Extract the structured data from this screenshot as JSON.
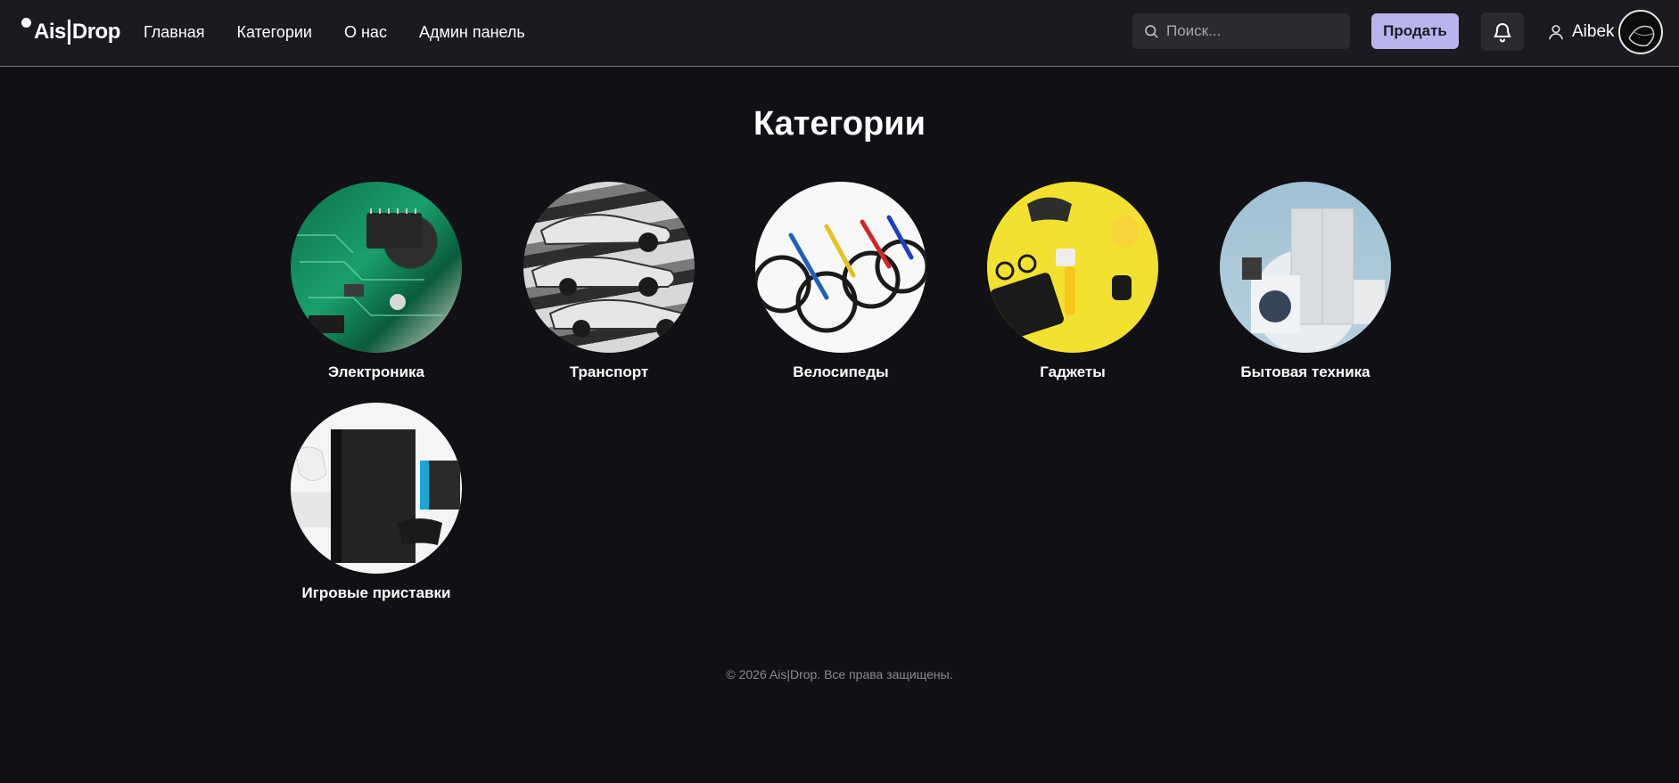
{
  "header": {
    "logo_left": "Ais",
    "logo_right": "Drop",
    "nav": [
      {
        "label": "Главная"
      },
      {
        "label": "Категории"
      },
      {
        "label": "О нас"
      },
      {
        "label": "Админ панель"
      }
    ],
    "search_placeholder": "Поиск...",
    "sell_label": "Продать",
    "username": "Aibek"
  },
  "main": {
    "title": "Категории",
    "categories": [
      {
        "label": "Электроника",
        "image": "circuit-board-image"
      },
      {
        "label": "Транспорт",
        "image": "cars-image"
      },
      {
        "label": "Велосипеды",
        "image": "bicycles-image"
      },
      {
        "label": "Гаджеты",
        "image": "gadgets-image"
      },
      {
        "label": "Бытовая техника",
        "image": "home-appliances-image"
      },
      {
        "label": "Игровые приставки",
        "image": "game-consoles-image"
      }
    ]
  },
  "footer": {
    "copyright": "© 2026 Ais|Drop. Все права защищены."
  },
  "colors": {
    "background": "#111015",
    "header": "#1b1a20",
    "accent": "#bab4ee"
  }
}
